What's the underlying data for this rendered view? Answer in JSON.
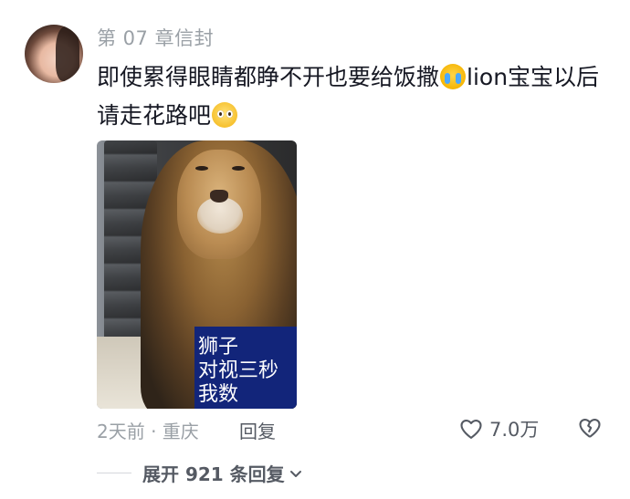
{
  "comment": {
    "username": "第 07 章信封",
    "text_part1": "即使累得眼睛都睁不开也要给饭撒",
    "emoji1": "crying-face",
    "text_part2": "lion宝宝以后请走花路吧",
    "emoji2": "pleading-face",
    "image": {
      "caption_lines": [
        "狮子",
        "对视三秒",
        "我数"
      ]
    },
    "meta": "2天前 · 重庆",
    "reply_label": "回复",
    "likes": "7.0万",
    "expand_label": "展开 921 条回复"
  },
  "colors": {
    "caption_bg": "#12257a",
    "text_primary": "#161823",
    "text_secondary": "#9aa0a6"
  },
  "icons": [
    "heart-icon",
    "broken-heart-icon",
    "chevron-down-icon"
  ]
}
